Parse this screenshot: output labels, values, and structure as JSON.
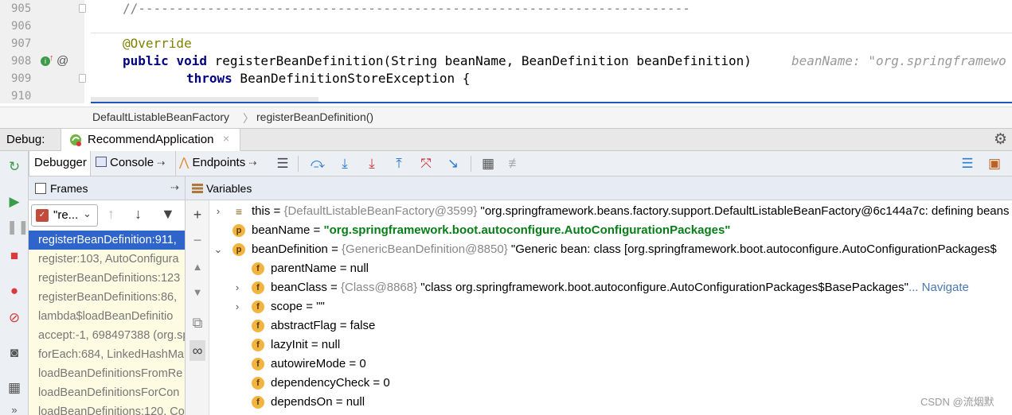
{
  "editor": {
    "lines": [
      {
        "num": "905",
        "code": "//------------------------------------------------------------------------"
      },
      {
        "num": "906",
        "code": ""
      },
      {
        "num": "907",
        "code": "@Override"
      },
      {
        "num": "908",
        "code_parts": [
          "public",
          " ",
          "void",
          " registerBeanDefinition(String beanName, BeanDefinition beanDefinition)"
        ]
      },
      {
        "num": "909",
        "code_parts": [
          "throws",
          " BeanDefinitionStoreException {"
        ]
      },
      {
        "num": "910",
        "code": ""
      }
    ],
    "inline_hint": "beanName: \"org.springframewo"
  },
  "breadcrumb": {
    "class_name": "DefaultListableBeanFactory",
    "separator": "〉",
    "method_name": "registerBeanDefinition()"
  },
  "debug": {
    "label": "Debug:",
    "run_config": "RecommendApplication",
    "close_icon": "×"
  },
  "toolbar": {
    "tabs": [
      {
        "label": "Debugger"
      },
      {
        "label": "Console",
        "pin": "⇢"
      },
      {
        "label": "Endpoints",
        "pin": "⇢"
      }
    ],
    "buttons": [
      "show-execution-point-icon",
      "step-over-icon",
      "step-into-icon",
      "force-step-into-icon",
      "step-out-icon",
      "drop-frame-icon",
      "run-to-cursor-icon",
      "evaluate-expression-icon",
      "trace-stream-icon"
    ]
  },
  "frames": {
    "title": "Frames",
    "pin": "⇢",
    "thread": "\"re...",
    "items": [
      {
        "text": "registerBeanDefinition:911, "
      },
      {
        "text": "register:103, AutoConfigura"
      },
      {
        "text": "registerBeanDefinitions:123"
      },
      {
        "text": "registerBeanDefinitions:86, "
      },
      {
        "text": "lambda$loadBeanDefinitio"
      },
      {
        "text": "accept:-1, 698497388 (org.sp"
      },
      {
        "text": "forEach:684, LinkedHashMa"
      },
      {
        "text": "loadBeanDefinitionsFromRe"
      },
      {
        "text": "loadBeanDefinitionsForCon"
      },
      {
        "text": "loadBeanDefinitions:120, Co"
      }
    ]
  },
  "variables": {
    "title": "Variables",
    "rows": [
      {
        "indent": 0,
        "expand": "›",
        "icon": "≡",
        "name": "this",
        "eq": " = ",
        "ref": "{DefaultListableBeanFactory@3599}",
        "value": " \"org.springframework.beans.factory.support.DefaultListableBeanFactory@6c144a7c: defining beans"
      },
      {
        "indent": 0,
        "expand": "",
        "icon": "p",
        "name": "beanName",
        "eq": " = ",
        "ref": "",
        "str": "\"org.springframework.boot.autoconfigure.AutoConfigurationPackages\""
      },
      {
        "indent": 0,
        "expand": "⌄",
        "icon": "p",
        "name": "beanDefinition",
        "eq": " = ",
        "ref": "{GenericBeanDefinition@8850}",
        "value": " \"Generic bean: class [org.springframework.boot.autoconfigure.AutoConfigurationPackages$"
      },
      {
        "indent": 1,
        "expand": "",
        "icon": "f",
        "name": "parentName",
        "eq": " = ",
        "value": "null"
      },
      {
        "indent": 1,
        "expand": "›",
        "icon": "f",
        "name": "beanClass",
        "eq": " = ",
        "ref": "{Class@8868}",
        "value": " \"class org.springframework.boot.autoconfigure.AutoConfigurationPackages$BasePackages\"",
        "link": "... Navigate"
      },
      {
        "indent": 1,
        "expand": "›",
        "icon": "f",
        "name": "scope",
        "eq": " = ",
        "value": "\"\""
      },
      {
        "indent": 1,
        "expand": "",
        "icon": "f",
        "name": "abstractFlag",
        "eq": " = ",
        "value": "false"
      },
      {
        "indent": 1,
        "expand": "",
        "icon": "f",
        "name": "lazyInit",
        "eq": " = ",
        "value": "null"
      },
      {
        "indent": 1,
        "expand": "",
        "icon": "f",
        "name": "autowireMode",
        "eq": " = ",
        "value": "0"
      },
      {
        "indent": 1,
        "expand": "",
        "icon": "f",
        "name": "dependencyCheck",
        "eq": " = ",
        "value": "0"
      },
      {
        "indent": 1,
        "expand": "",
        "icon": "f",
        "name": "dependsOn",
        "eq": " = ",
        "value": "null"
      }
    ]
  },
  "watermark": "CSDN @流烟默",
  "colors": {
    "selection": "#2f65ca",
    "string_value": "#067d17",
    "keyword": "#000080",
    "annotation": "#808000"
  }
}
